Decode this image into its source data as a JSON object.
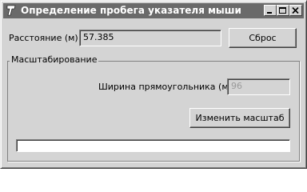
{
  "window": {
    "title": "Определение пробега указателя мыши",
    "icon": "delphi-helmet-icon"
  },
  "distance": {
    "label": "Расстояние (м):",
    "value": "57.385"
  },
  "reset_button": {
    "label": "Сброс"
  },
  "scaling_group": {
    "legend": "Масштабирование",
    "rect_width_label": "Ширина прямоугольника (мм):",
    "rect_width_value": "96",
    "change_scale_button": "Изменить масштаб"
  },
  "progress": {
    "value": 0
  }
}
